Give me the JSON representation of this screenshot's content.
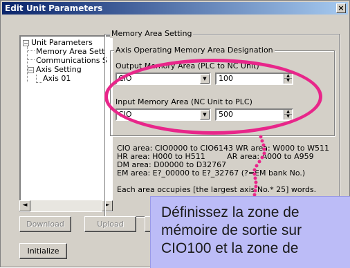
{
  "window": {
    "title": "Edit Unit Parameters",
    "close_glyph": "×"
  },
  "tree": {
    "items": [
      {
        "label": "Unit Parameters",
        "expander": "−"
      },
      {
        "label": "Memory Area Sett"
      },
      {
        "label": "Communications S"
      },
      {
        "label": "Axis Setting",
        "expander": "−"
      },
      {
        "label": "Axis 01"
      }
    ],
    "scroll_left": "◄",
    "scroll_right": "►"
  },
  "memory_group": {
    "title": "Memory Area Setting",
    "axis_group_title": "Axis Operating Memory Area Designation",
    "output_label": "Output Memory Area (PLC to NC Unit)",
    "output_area": "CIO",
    "output_address": "100",
    "input_label": "Input Memory Area (NC Unit to PLC)",
    "input_area": "CIO",
    "input_address": "500"
  },
  "info": {
    "lines": [
      "CIO area: CIO0000 to CIO6143  WR area: W000 to W511",
      "HR area: H000 to H511         AR area: A000 to A959",
      "DM area: D00000 to D32767",
      "EM area: E?_00000 to E?_32767 (?=EM bank No.)"
    ],
    "note": "Each area occupies [the largest axis No.* 25] words."
  },
  "buttons": {
    "download": "Download",
    "upload": "Upload",
    "initialize": "Initialize"
  },
  "callout": {
    "text_line1": "Définissez la zone de",
    "text_line2": "mémoire de sortie sur",
    "text_line3": "CIO100 et la zone de"
  },
  "colors": {
    "accent_annotation": "#e8268a",
    "callout_background": "#bcbcf7",
    "titlebar": "#0a246a"
  }
}
